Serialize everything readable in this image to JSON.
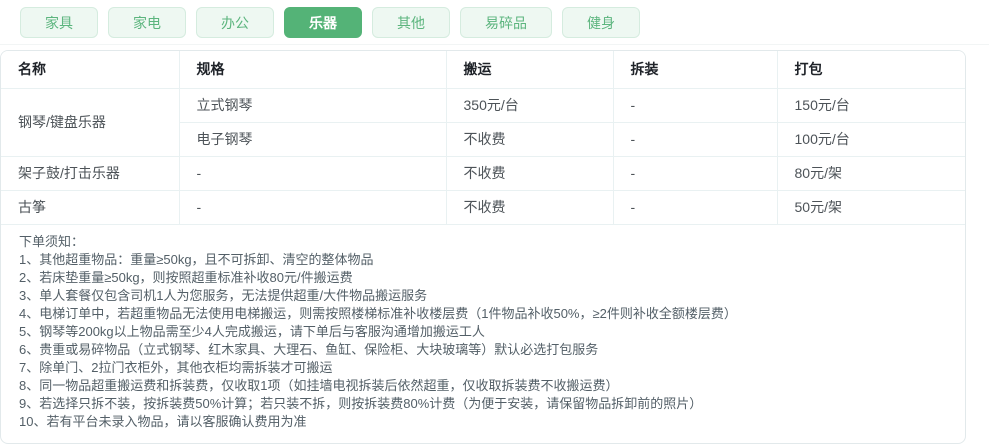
{
  "colors": {
    "accent_green": "#54b377",
    "tab_inactive_bg": "#eef8f2",
    "tab_inactive_text": "#5cb57e",
    "grid_line": "#e9f1f2"
  },
  "tabs": {
    "items": [
      {
        "label": "家具",
        "active": false
      },
      {
        "label": "家电",
        "active": false
      },
      {
        "label": "办公",
        "active": false
      },
      {
        "label": "乐器",
        "active": true
      },
      {
        "label": "其他",
        "active": false
      },
      {
        "label": "易碎品",
        "active": false
      },
      {
        "label": "健身",
        "active": false
      }
    ]
  },
  "table": {
    "headers": [
      "名称",
      "规格",
      "搬运",
      "拆装",
      "打包"
    ],
    "rows": [
      {
        "name": "钢琴/键盘乐器",
        "spec": "立式钢琴",
        "move": "350元/台",
        "disassembly": "-",
        "pack": "150元/台"
      },
      {
        "name": "",
        "spec": "电子钢琴",
        "move": "不收费",
        "disassembly": "-",
        "pack": "100元/台"
      },
      {
        "name": "架子鼓/打击乐器",
        "spec": "-",
        "move": "不收费",
        "disassembly": "-",
        "pack": "80元/架"
      },
      {
        "name": "古筝",
        "spec": "-",
        "move": "不收费",
        "disassembly": "-",
        "pack": "50元/架"
      }
    ]
  },
  "notes": {
    "title": "下单须知：",
    "items": [
      "1、其他超重物品：重量≥50kg，且不可拆卸、清空的整体物品",
      "2、若床垫重量≥50kg，则按照超重标准补收80元/件搬运费",
      "3、单人套餐仅包含司机1人为您服务，无法提供超重/大件物品搬运服务",
      "4、电梯订单中，若超重物品无法使用电梯搬运，则需按照楼梯标准补收楼层费（1件物品补收50%，≥2件则补收全额楼层费）",
      "5、钢琴等200kg以上物品需至少4人完成搬运，请下单后与客服沟通增加搬运工人",
      "6、贵重或易碎物品（立式钢琴、红木家具、大理石、鱼缸、保险柜、大块玻璃等）默认必选打包服务",
      "7、除单门、2拉门衣柜外，其他衣柜均需拆装才可搬运",
      "8、同一物品超重搬运费和拆装费，仅收取1项（如挂墙电视拆装后依然超重，仅收取拆装费不收搬运费）",
      "9、若选择只拆不装，按拆装费50%计算；若只装不拆，则按拆装费80%计费（为便于安装，请保留物品拆卸前的照片）",
      "10、若有平台未录入物品，请以客服确认费用为准"
    ]
  }
}
